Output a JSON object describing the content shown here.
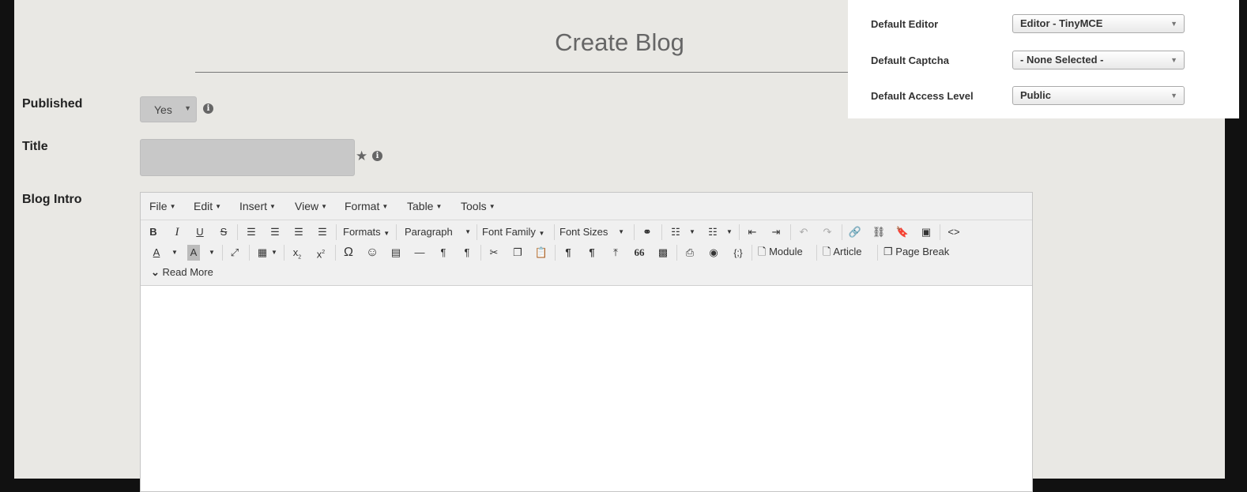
{
  "form": {
    "heading": "Create Blog",
    "published_label": "Published",
    "published_value": "Yes",
    "title_label": "Title",
    "title_value": "",
    "intro_label": "Blog Intro"
  },
  "editor": {
    "menus": [
      "File",
      "Edit",
      "Insert",
      "View",
      "Format",
      "Table",
      "Tools"
    ],
    "dropdowns": {
      "formats": "Formats",
      "paragraph": "Paragraph",
      "font_family": "Font Family",
      "font_sizes": "Font Sizes"
    },
    "buttons": {
      "module": "Module",
      "article": "Article",
      "page_break": "Page Break",
      "read_more": "Read More"
    }
  },
  "settings": {
    "editor_label": "Default Editor",
    "editor_value": "Editor - TinyMCE",
    "captcha_label": "Default Captcha",
    "captcha_value": "- None Selected -",
    "access_label": "Default Access Level",
    "access_value": "Public"
  },
  "icons": {
    "bold": "B",
    "italic": "I",
    "underline": "U",
    "strike": "S",
    "text_color": "A",
    "bg_color": "A",
    "omega": "Ω",
    "smile": "☺",
    "pilcrow": "¶",
    "quote": "66",
    "braces": "{;}",
    "code": "<>",
    "subscript": "x",
    "superscript": "x",
    "sub_mark": "2",
    "sup_mark": "2"
  },
  "colors": {
    "accent": "#666666",
    "page_bg": "#e9e8e4",
    "frame": "#111111"
  }
}
